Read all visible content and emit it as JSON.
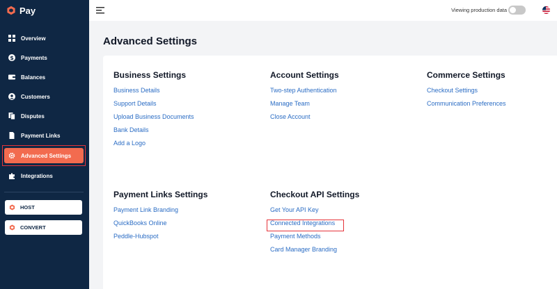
{
  "app": {
    "logo_text": "Pay"
  },
  "sidebar": {
    "items": [
      {
        "label": "Overview",
        "icon": "grid-icon"
      },
      {
        "label": "Payments",
        "icon": "dollar-icon"
      },
      {
        "label": "Balances",
        "icon": "wallet-icon"
      },
      {
        "label": "Customers",
        "icon": "user-icon"
      },
      {
        "label": "Disputes",
        "icon": "documents-icon"
      },
      {
        "label": "Payment Links",
        "icon": "document-icon"
      },
      {
        "label": "Advanced Settings",
        "icon": "gear-icon",
        "active": true
      },
      {
        "label": "Integrations",
        "icon": "puzzle-icon"
      }
    ],
    "apps": [
      {
        "label": "HOST",
        "icon": "hexagon-icon"
      },
      {
        "label": "CONVERT",
        "icon": "hexagon-icon"
      }
    ]
  },
  "topbar": {
    "production_label": "Viewing production data",
    "production_toggle": false
  },
  "page": {
    "title": "Advanced Settings"
  },
  "sections": [
    {
      "title": "Business Settings",
      "links": [
        "Business Details",
        "Support Details",
        "Upload Business Documents",
        "Bank Details",
        "Add a Logo"
      ]
    },
    {
      "title": "Account Settings",
      "links": [
        "Two-step Authentication",
        "Manage Team",
        "Close Account"
      ]
    },
    {
      "title": "Commerce Settings",
      "links": [
        "Checkout Settings",
        "Communication Preferences"
      ]
    },
    {
      "title": "Payment Links Settings",
      "links": [
        "Payment Link Branding",
        "QuickBooks Online",
        "Peddle-Hubspot"
      ]
    },
    {
      "title": "Checkout API Settings",
      "links": [
        "Get Your API Key",
        "Connected Integrations",
        "Payment Methods",
        "Card Manager Branding"
      ]
    }
  ],
  "colors": {
    "sidebar_bg": "#0f2744",
    "accent": "#f26b4f",
    "link": "#2a6cc4",
    "highlight": "#e5333a"
  }
}
